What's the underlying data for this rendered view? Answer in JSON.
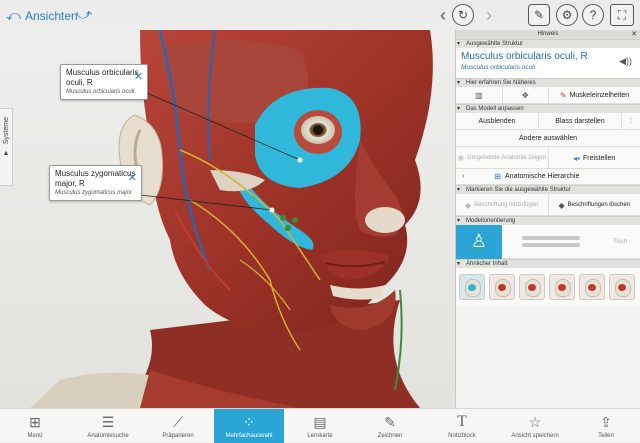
{
  "header": {
    "back_label": "Ansichten"
  },
  "sidebar_tab": {
    "label": "Systeme"
  },
  "callouts": [
    {
      "name": "Musculus orbicularis oculi, R",
      "latin": "Musculus orbicularis oculi"
    },
    {
      "name": "Musculus zygomaticus major, R",
      "latin": "Musculus zygomaticus major"
    }
  ],
  "toolbar": [
    {
      "label": "Menü",
      "icon": "grid-icon"
    },
    {
      "label": "Anatomiesuche",
      "icon": "search-list-icon"
    },
    {
      "label": "Präparieren",
      "icon": "scalpel-icon"
    },
    {
      "label": "Mehrfachauswahl",
      "icon": "multi-select-icon",
      "active": true
    },
    {
      "label": "Lernkarte",
      "icon": "flashcard-icon"
    },
    {
      "label": "Zeichnen",
      "icon": "pencil-icon"
    },
    {
      "label": "Notizblock",
      "icon": "text-icon"
    },
    {
      "label": "Ansicht speichern",
      "icon": "star-icon"
    },
    {
      "label": "Teilen",
      "icon": "share-icon"
    }
  ],
  "panel": {
    "title": "Hinweis",
    "section_selected": "Ausgewählte Struktur",
    "structure_name": "Musculus orbicularis oculi, R",
    "structure_latin": "Musculus orbicularis oculi",
    "section_learn": "Hier erfahren Sie Näheres",
    "muscle_details": "Muskeleinzelheiten",
    "section_adjust": "Das Modell anpassen",
    "hide": "Ausblenden",
    "fade": "Blass darstellen",
    "hide_others": "Andere auswählen",
    "show_surrounding": "Umgebende Anatomie zeigen",
    "isolate": "Freistellen",
    "hierarchy": "Anatomische Hierarchie",
    "section_mark": "Markieren Sie die ausgewählte Struktur",
    "label_create": "Beschriftung hinzufügen",
    "label_delete": "Beschriftungen löschen",
    "section_orientation": "Modellorientierung",
    "orientation_table": "Tisch",
    "section_similar": "Ähnlicher Inhalt"
  },
  "colors": {
    "accent": "#2ba4d6",
    "link": "#1f6fb8",
    "highlight_muscle": "#2fb8d9"
  }
}
